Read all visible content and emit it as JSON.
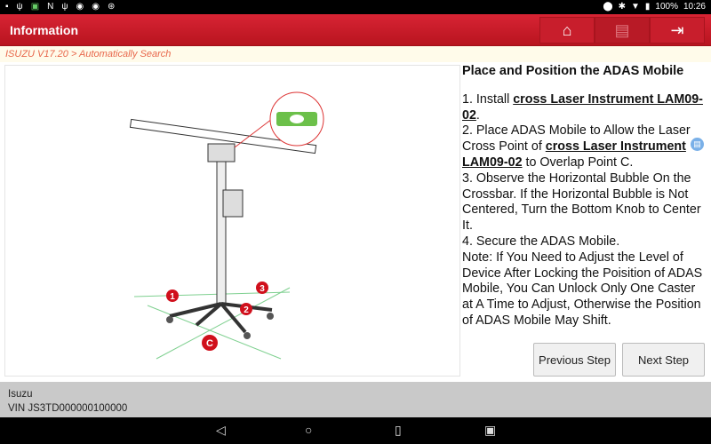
{
  "status_bar": {
    "battery": "100%",
    "time": "10:26"
  },
  "header": {
    "title": "Information",
    "buttons": [
      "home-icon",
      "print-icon",
      "exit-icon"
    ]
  },
  "breadcrumb": "ISUZU V17.20 > Automatically Search",
  "content": {
    "title": "Place and Position the ADAS Mobile",
    "steps": [
      {
        "pre": "1. Install ",
        "link": "cross Laser Instrument LAM09-02",
        "post": "."
      },
      {
        "pre": "2. Place ADAS Mobile to Allow the Laser Cross Point of ",
        "link": "cross Laser Instrument LAM09-02",
        "post": " to Overlap Point C."
      },
      {
        "pre": "3. Observe the Horizontal Bubble On the Crossbar. If the Horizontal Bubble is Not Centered, Turn the Bottom Knob to Center It."
      },
      {
        "pre": "4. Secure the ADAS Mobile."
      },
      {
        "pre": "Note: If You Need to Adjust the Level of Device After Locking the Poisition of ADAS Mobile, You Can Unlock Only One Caster at A Time to Adjust, Otherwise the Position of ADAS Mobile May Shift."
      }
    ],
    "figure_labels": [
      "1",
      "2",
      "3",
      "C"
    ]
  },
  "buttons": {
    "previous": "Previous Step",
    "next": "Next Step"
  },
  "footer": {
    "make": "Isuzu",
    "vin": "VIN JS3TD000000100000"
  },
  "colors": {
    "header": "#c81e2c",
    "breadcrumb_text": "#e8664a",
    "accent_green": "#6cc04a",
    "label_red": "#d0101c"
  }
}
